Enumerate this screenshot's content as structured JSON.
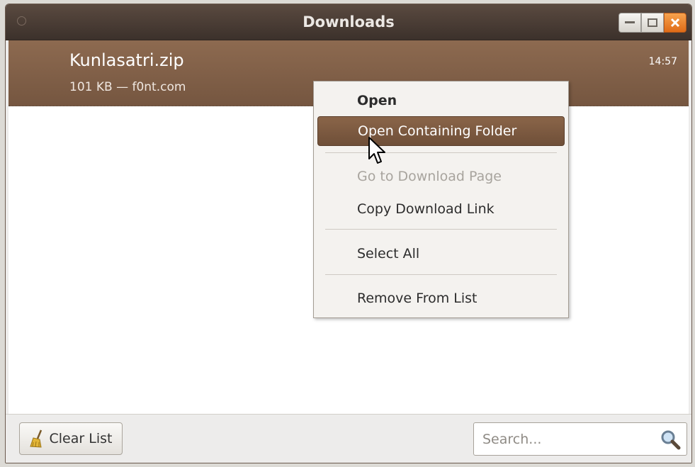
{
  "window": {
    "title": "Downloads"
  },
  "download": {
    "filename": "Kunlasatri.zip",
    "meta": "101 KB — f0nt.com",
    "time": "14:57"
  },
  "context_menu": {
    "items": [
      {
        "label": "Open",
        "mnemonic": "O",
        "state": "default"
      },
      {
        "label": "Open Containing Folder",
        "mnemonic": "F",
        "state": "hover"
      },
      {
        "label": "Go to Download Page",
        "mnemonic": "G",
        "state": "disabled"
      },
      {
        "label": "Copy Download Link",
        "mnemonic": "L",
        "state": "normal"
      },
      {
        "label": "Select All",
        "mnemonic": "A",
        "state": "normal"
      },
      {
        "label": "Remove From List",
        "mnemonic": "e",
        "state": "normal"
      }
    ]
  },
  "toolbar": {
    "clear_label": "Clear List",
    "clear_icon": "broom-icon"
  },
  "search": {
    "placeholder": "Search...",
    "icon": "magnifier-icon"
  },
  "colors": {
    "titlebar": "#4a3c33",
    "selected_row": "#806048",
    "accent": "#e2761f",
    "menu_hover": "#7c5a40"
  }
}
